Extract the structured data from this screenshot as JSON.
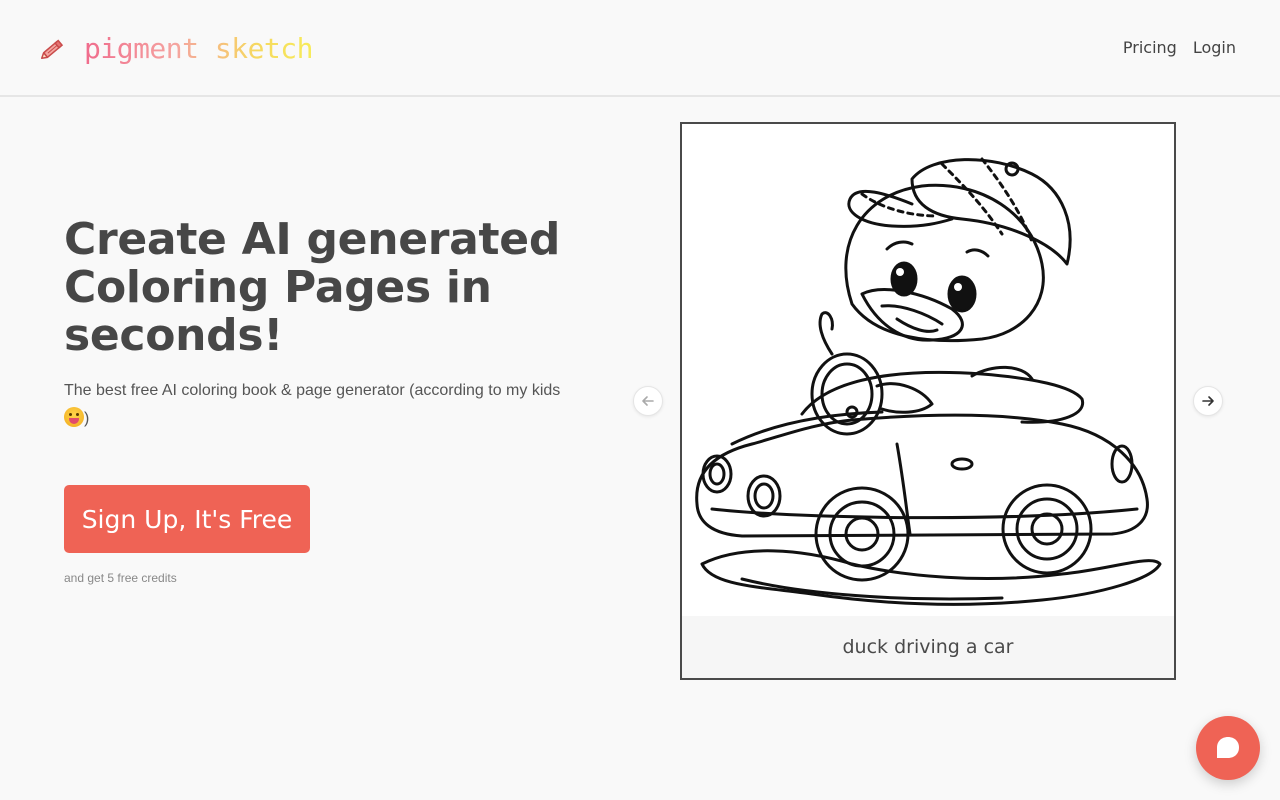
{
  "brand": {
    "name": "pigment sketch",
    "logo_icon": "pencil-icon"
  },
  "nav": {
    "pricing": "Pricing",
    "login": "Login"
  },
  "hero": {
    "title": "Create AI generated Coloring Pages in seconds!",
    "subtitle": "The best free AI coloring book & page generator (according to my kids",
    "subtitle_end": ")",
    "emoji_icon": "grinning-face-emoji",
    "cta_label": "Sign Up, It's Free",
    "cta_note": "and get 5 free credits"
  },
  "carousel": {
    "prev_icon": "arrow-left-icon",
    "next_icon": "arrow-right-icon",
    "current_caption": "duck driving a car"
  },
  "chat": {
    "icon": "chat-bubble-icon"
  },
  "colors": {
    "accent": "#ef6355",
    "text": "#444444",
    "background": "#f9f9f9"
  }
}
